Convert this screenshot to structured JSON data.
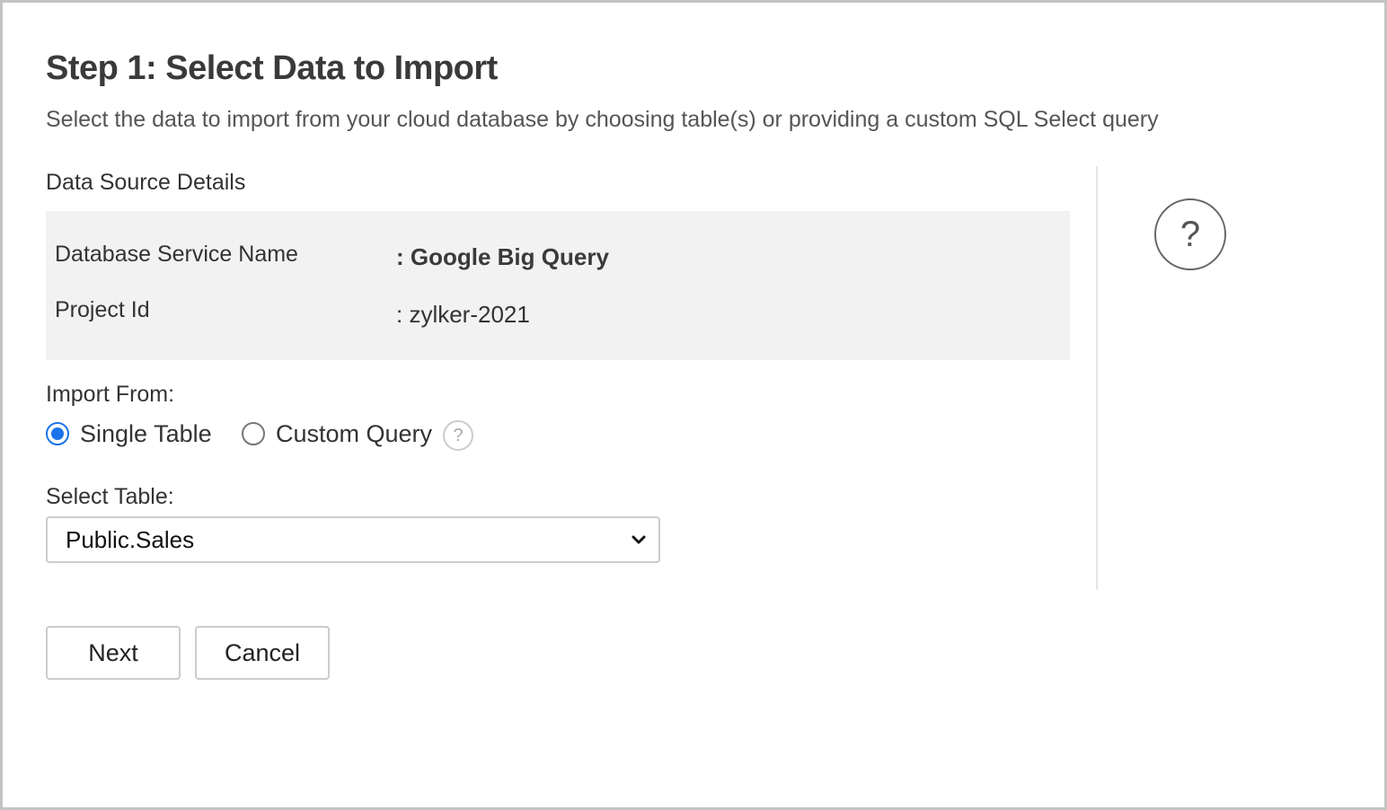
{
  "header": {
    "title": "Step 1: Select Data to Import",
    "subtitle": "Select the data to import from your cloud database by choosing table(s) or providing a custom SQL Select query"
  },
  "data_source": {
    "section_label": "Data Source Details",
    "rows": [
      {
        "key": "Database Service Name",
        "value": ": Google Big Query"
      },
      {
        "key": "Project Id",
        "value": ": zylker-2021"
      }
    ]
  },
  "help": {
    "glyph": "?"
  },
  "import_from": {
    "label": "Import From:",
    "options": [
      {
        "label": "Single Table",
        "selected": true
      },
      {
        "label": "Custom Query",
        "selected": false
      }
    ],
    "help_glyph": "?"
  },
  "select_table": {
    "label": "Select Table:",
    "selected_value": "Public.Sales"
  },
  "buttons": {
    "next": "Next",
    "cancel": "Cancel"
  },
  "colors": {
    "accent": "#1a73e8",
    "details_background": "#f2f2f2",
    "border": "#cccccc"
  },
  "icons": {
    "help": "question-mark-circle-icon",
    "dropdown": "chevron-down-icon"
  }
}
